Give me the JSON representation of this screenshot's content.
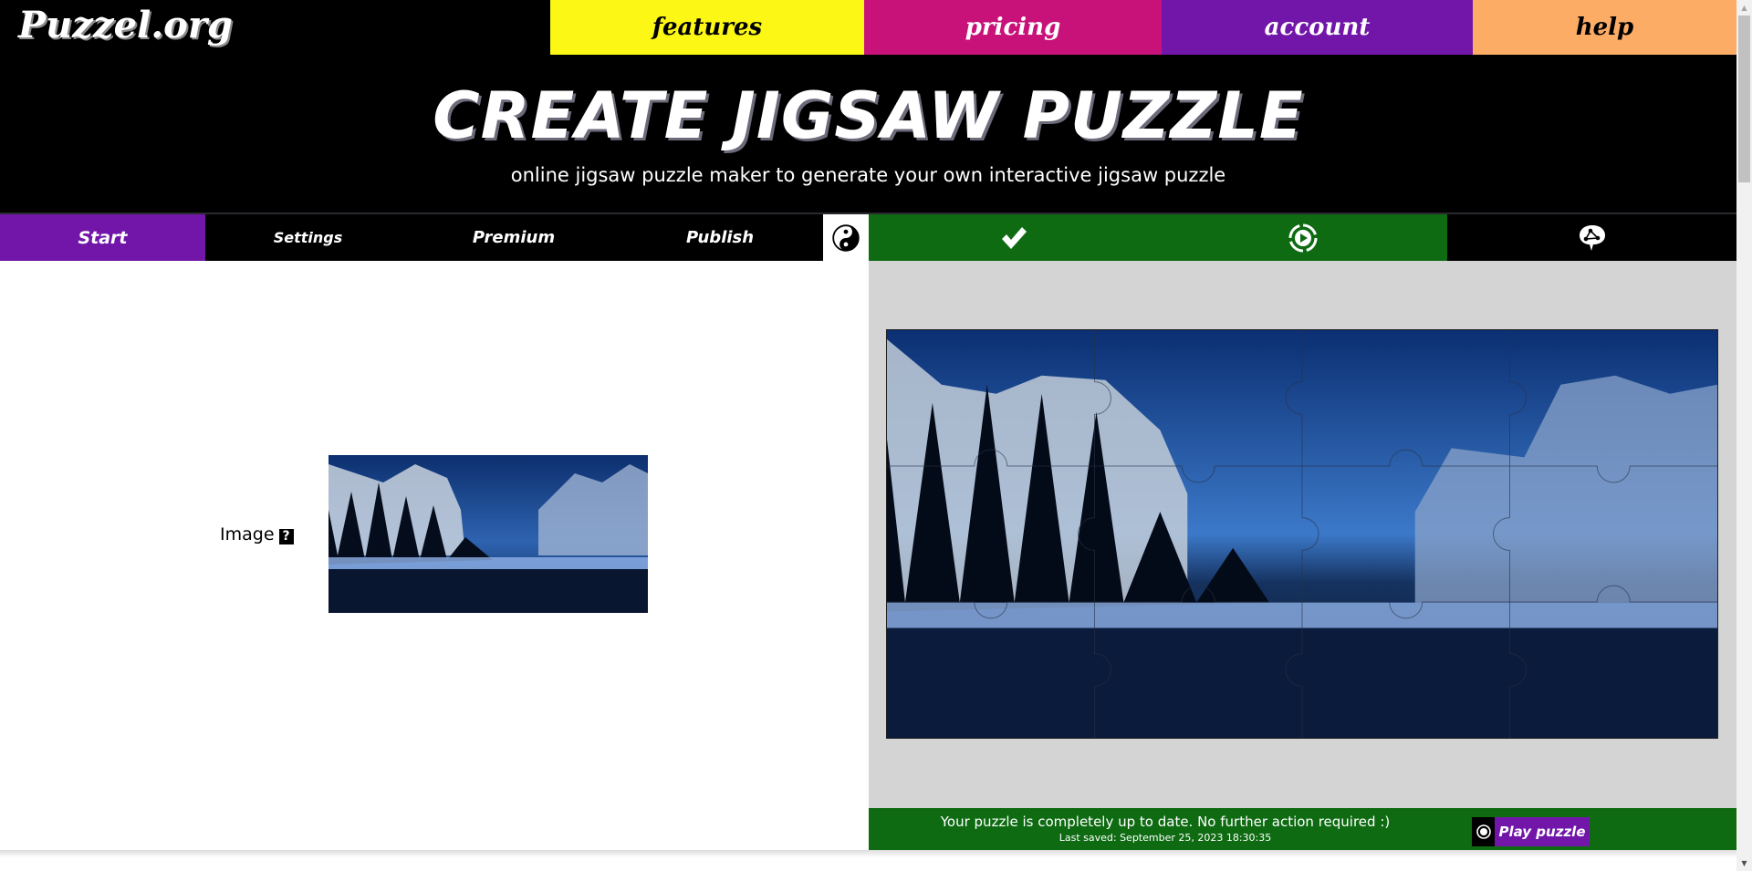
{
  "header": {
    "logo": "Puzzel.org",
    "nav": [
      {
        "label": "features",
        "color": "#fcf714"
      },
      {
        "label": "pricing",
        "color": "#c8127a"
      },
      {
        "label": "account",
        "color": "#7116a8"
      },
      {
        "label": "help",
        "color": "#fdac66"
      }
    ],
    "title": "CREATE JIGSAW PUZZLE",
    "subtitle": "online jigsaw puzzle maker to generate your own interactive jigsaw puzzle"
  },
  "tabs": [
    {
      "label": "Start",
      "active": true
    },
    {
      "label": "Settings",
      "active": false
    },
    {
      "label": "Premium",
      "active": false
    },
    {
      "label": "Publish",
      "active": false
    }
  ],
  "toolbar": {
    "theme_icon": "yin-yang-icon",
    "actions": [
      {
        "icon": "checkmark-icon",
        "name": "save"
      },
      {
        "icon": "play-circle-icon",
        "name": "play"
      },
      {
        "icon": "share-bubble-icon",
        "name": "share"
      }
    ]
  },
  "editor": {
    "image_label": "Image",
    "help_glyph": "?",
    "image_alt": "Snowy mountain landscape with pine trees and river reflection"
  },
  "preview": {
    "grid_cols": 4,
    "grid_rows": 3
  },
  "status": {
    "message": "Your puzzle is completely up to date. No further action required :)",
    "last_saved": "Last saved: September 25, 2023 18:30:35",
    "play_button": "Play puzzle"
  },
  "colors": {
    "purple": "#7116a8",
    "green": "#0e6b12",
    "panel_gray": "#d4d4d4"
  }
}
